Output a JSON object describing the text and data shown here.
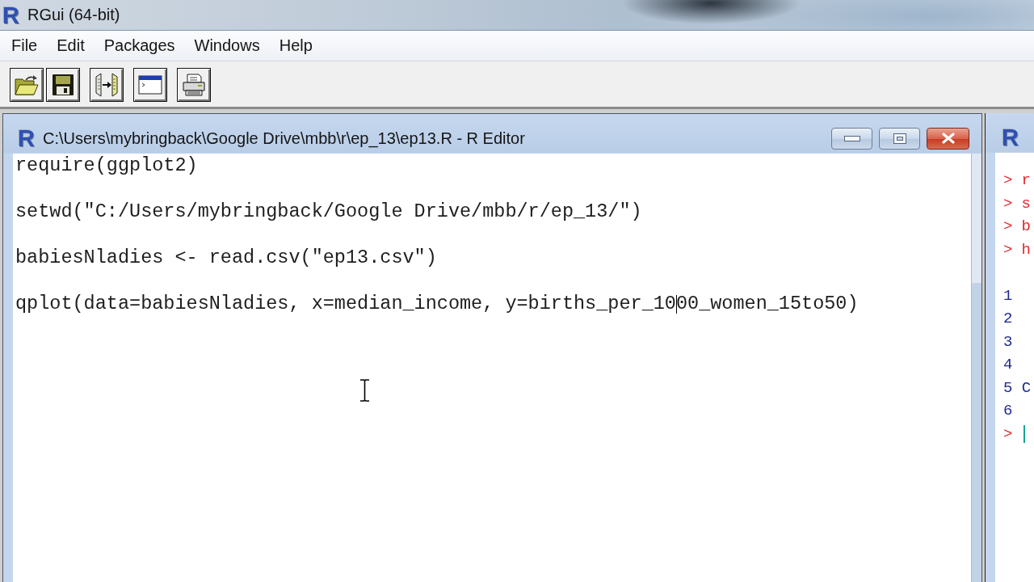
{
  "app_window": {
    "logo": "R",
    "title": "RGui (64-bit)"
  },
  "menu_bar": [
    {
      "label": "File"
    },
    {
      "label": "Edit"
    },
    {
      "label": "Packages"
    },
    {
      "label": "Windows"
    },
    {
      "label": "Help"
    }
  ],
  "editor_window": {
    "logo": "R",
    "title": "C:\\Users\\mybringback\\Google Drive\\mbb\\r\\ep_13\\ep13.R - R Editor",
    "lines": [
      {
        "text": "require(ggplot2)",
        "caret": false
      },
      {
        "text": "setwd(\"C:/Users/mybringback/Google Drive/mbb/r/ep_13/\")",
        "caret": false
      },
      {
        "text": "babiesNladies <- read.csv(\"ep13.csv\")",
        "caret": false
      },
      {
        "text": "qplot(data=babiesNladies, x=median_income, y=births_per_10",
        "caret": true,
        "text_after_caret": "00_women_15to50)"
      }
    ]
  },
  "console_window": {
    "logo": "R",
    "lines": [
      {
        "kind": "input",
        "prompt": ">",
        "text": "r",
        "caret": false
      },
      {
        "kind": "input",
        "prompt": ">",
        "text": "s",
        "caret": false
      },
      {
        "kind": "input",
        "prompt": ">",
        "text": "b",
        "caret": false
      },
      {
        "kind": "input",
        "prompt": ">",
        "text": "h",
        "caret": false
      },
      {
        "kind": "blank",
        "caret": false
      },
      {
        "kind": "output",
        "text": "1",
        "caret": false
      },
      {
        "kind": "output",
        "text": "2",
        "caret": false
      },
      {
        "kind": "output",
        "text": "3",
        "caret": false
      },
      {
        "kind": "output",
        "text": "4",
        "caret": false
      },
      {
        "kind": "output",
        "text": "5 C",
        "caret": false
      },
      {
        "kind": "output",
        "text": "6",
        "caret": false
      },
      {
        "kind": "input",
        "prompt": ">",
        "caret": true
      }
    ]
  }
}
